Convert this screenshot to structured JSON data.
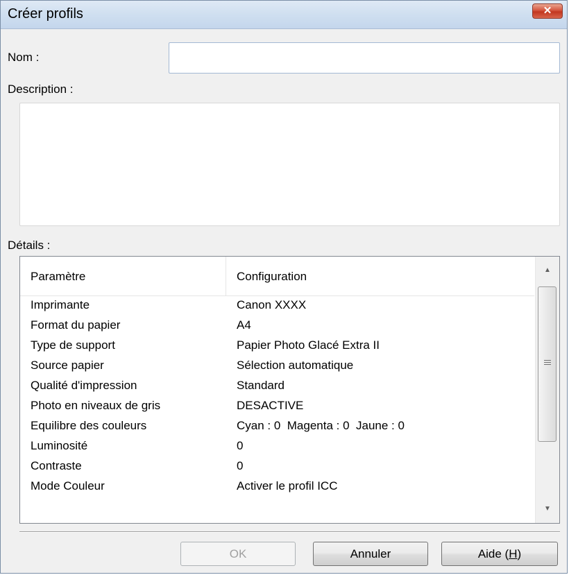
{
  "window": {
    "title": "Créer profils",
    "close_glyph": "✕"
  },
  "form": {
    "name_label": "Nom :",
    "name_value": "",
    "description_label": "Description :",
    "description_value": "",
    "details_label": "Détails :"
  },
  "details": {
    "columns": [
      "Paramètre",
      "Configuration"
    ],
    "rows": [
      {
        "param": "Imprimante",
        "value": "Canon XXXX"
      },
      {
        "param": "Format du papier",
        "value": "A4"
      },
      {
        "param": "Type de support",
        "value": "Papier Photo Glacé Extra II"
      },
      {
        "param": "Source papier",
        "value": "Sélection automatique"
      },
      {
        "param": "Qualité d'impression",
        "value": "Standard"
      },
      {
        "param": "Photo en niveaux de gris",
        "value": "DESACTIVE"
      },
      {
        "param": "Equilibre des couleurs",
        "value": "Cyan : 0  Magenta : 0  Jaune : 0"
      },
      {
        "param": "Luminosité",
        "value": "0"
      },
      {
        "param": "Contraste",
        "value": "0"
      },
      {
        "param": "Mode Couleur",
        "value": "Activer le profil ICC"
      }
    ]
  },
  "buttons": {
    "ok_label": "OK",
    "cancel_label": "Annuler",
    "help_label": "Aide (",
    "help_key": "H",
    "help_close": ")"
  },
  "icons": {
    "close": "close-icon",
    "scroll_up": "scroll-up-icon",
    "scroll_down": "scroll-down-icon"
  },
  "colors": {
    "title_bar": "#cfdff0",
    "close_button": "#c2361f",
    "dialog_bg": "#f0f0f0"
  }
}
